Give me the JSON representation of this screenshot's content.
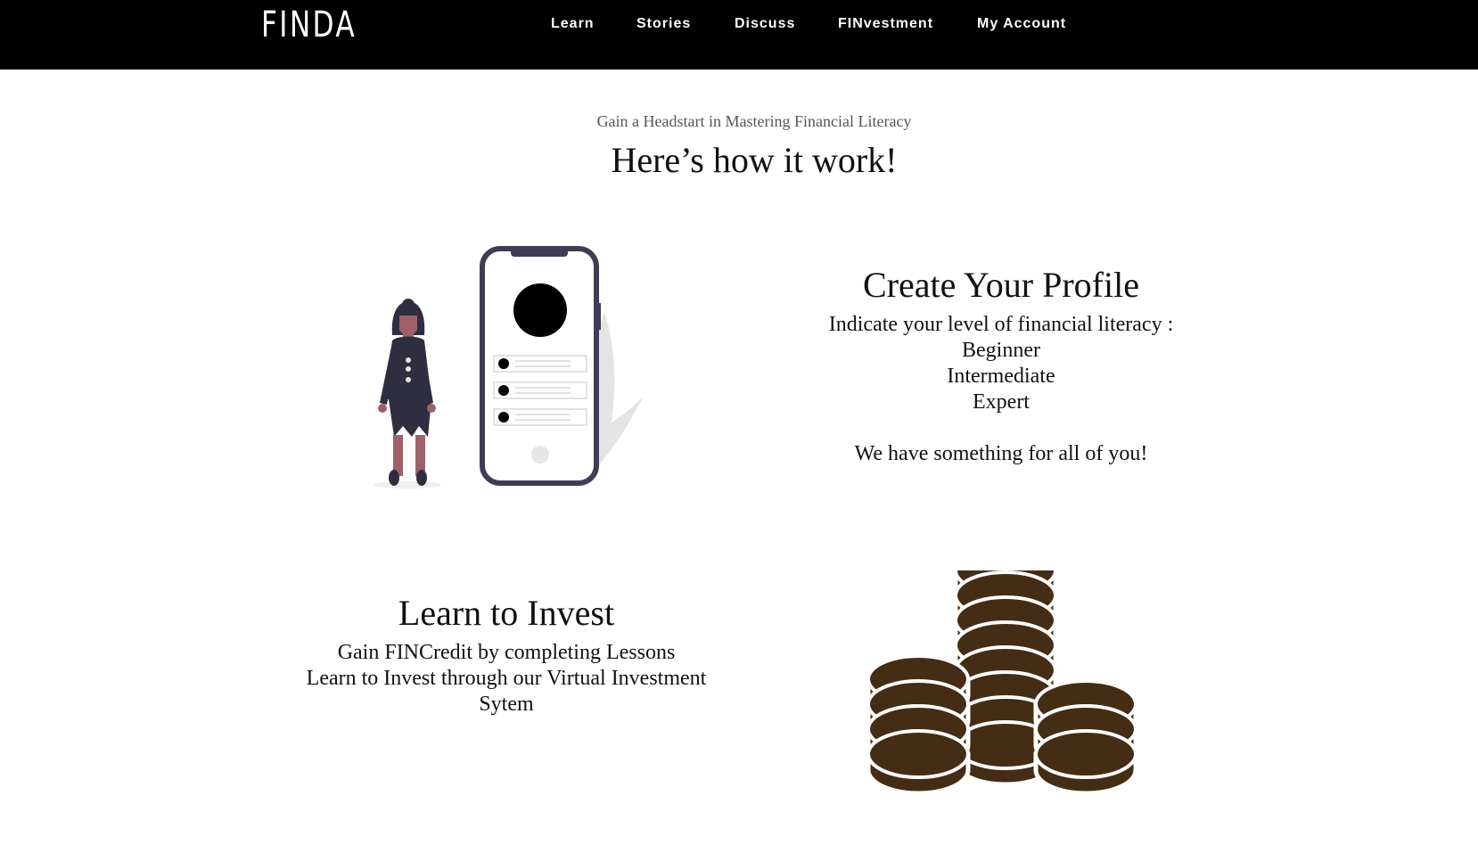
{
  "header": {
    "logo": "FINDA",
    "nav": [
      "Learn",
      "Stories",
      "Discuss",
      "FINvestment",
      "My Account"
    ]
  },
  "hero": {
    "tagline": "Gain a Headstart in Mastering Financial Literacy",
    "headline": "Here’s how it work!"
  },
  "steps": [
    {
      "title": "Create Your Profile",
      "lines": [
        "Indicate your level of financial literacy :",
        "Beginner",
        "Intermediate",
        "Expert",
        "",
        "We have something for all of you!"
      ]
    },
    {
      "title": "Learn to Invest",
      "lines": [
        "Gain FINCredit by completing Lessons",
        "Learn to Invest through our Virtual Investment",
        "Sytem"
      ]
    }
  ],
  "colors": {
    "header_bg": "#000000",
    "coin": "#452c15",
    "phone_frame": "#3f3d56"
  },
  "icons": [
    "person-with-phone-illustration",
    "coin-stacks-illustration"
  ]
}
